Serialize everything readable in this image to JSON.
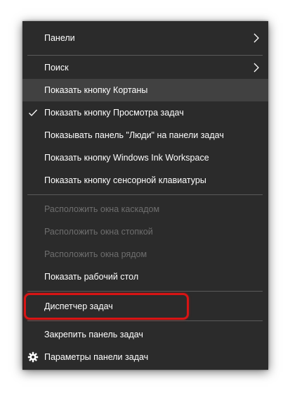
{
  "menu": {
    "items": [
      {
        "label": "Панели",
        "icon": "chevron-right-icon",
        "state": "normal"
      },
      {
        "label": "Поиск",
        "icon": "chevron-right-icon",
        "state": "normal"
      },
      {
        "label": "Показать кнопку Кортаны",
        "state": "hover"
      },
      {
        "label": "Показать кнопку Просмотра задач",
        "icon": "checkmark-icon",
        "checked": true,
        "state": "normal"
      },
      {
        "label": "Показывать панель \"Люди\" на панели задач",
        "state": "normal"
      },
      {
        "label": "Показать кнопку Windows Ink Workspace",
        "state": "normal"
      },
      {
        "label": "Показать кнопку сенсорной клавиатуры",
        "state": "normal"
      },
      {
        "label": "Расположить окна каскадом",
        "state": "disabled"
      },
      {
        "label": "Расположить окна стопкой",
        "state": "disabled"
      },
      {
        "label": "Расположить окна рядом",
        "state": "disabled"
      },
      {
        "label": "Показать рабочий стол",
        "state": "normal"
      },
      {
        "label": "Диспетчер задач",
        "state": "normal",
        "highlighted": true
      },
      {
        "label": "Закрепить панель задач",
        "state": "normal"
      },
      {
        "label": "Параметры панели задач",
        "icon": "gear-icon",
        "state": "normal"
      }
    ]
  },
  "colors": {
    "menu_bg": "#2b2b2b",
    "hover_bg": "#414141",
    "text": "#ffffff",
    "disabled_text": "#6e6e6e",
    "separator": "#5a5a5a",
    "highlight_border": "#d81414"
  }
}
